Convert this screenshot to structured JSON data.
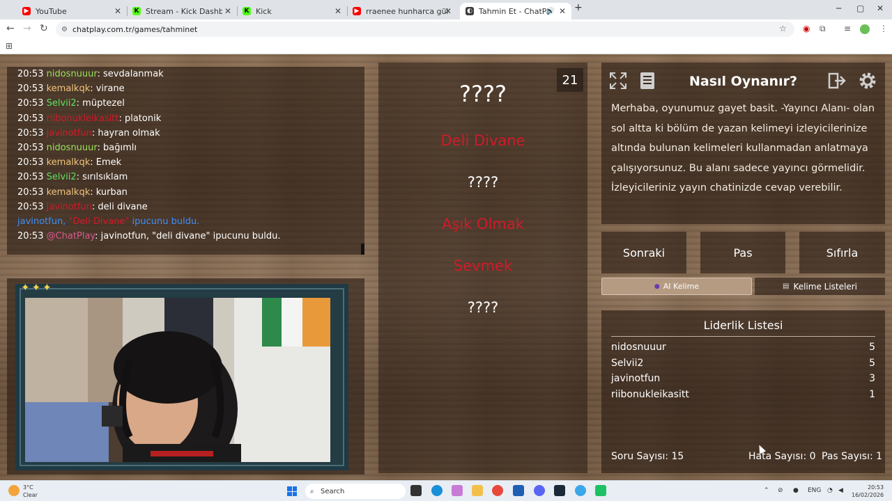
{
  "browser": {
    "tabs": [
      {
        "label": "YouTube",
        "favicon_color": "#ff0000",
        "favicon_glyph": "▶"
      },
      {
        "label": "Stream - Kick Dashboard",
        "favicon_color": "#53fc18",
        "favicon_glyph": "K"
      },
      {
        "label": "Kick",
        "favicon_color": "#53fc18",
        "favicon_glyph": "K"
      },
      {
        "label": "rraenee hunharca gülüyor - You",
        "favicon_color": "#ff0000",
        "favicon_glyph": "▶"
      },
      {
        "label": "Tahmin Et - ChatPlay",
        "favicon_color": "#3a3a3a",
        "favicon_glyph": "◐"
      }
    ],
    "url": "chatplay.com.tr/games/tahminet"
  },
  "chat": {
    "messages": [
      {
        "time": "20:53",
        "user": "nidosnuuur",
        "user_color": "#9be15d",
        "text": ": sevdalanmak"
      },
      {
        "time": "20:53",
        "user": "kemalkqk",
        "user_color": "#f2c57c",
        "text": ": virane"
      },
      {
        "time": "20:53",
        "user": "Selvii2",
        "user_color": "#5ee05e",
        "text": ": müptezel"
      },
      {
        "time": "20:53",
        "user": "riibonukleikasitt",
        "user_color": "#d11a2a",
        "text": ": platonik"
      },
      {
        "time": "20:53",
        "user": "javinotfun",
        "user_color": "#d11a2a",
        "text": ": hayran olmak"
      },
      {
        "time": "20:53",
        "user": "nidosnuuur",
        "user_color": "#9be15d",
        "text": ": bağımlı"
      },
      {
        "time": "20:53",
        "user": "kemalkqk",
        "user_color": "#f2c57c",
        "text": ": Emek"
      },
      {
        "time": "20:53",
        "user": "Selvii2",
        "user_color": "#5ee05e",
        "text": ": sırılsıklam"
      },
      {
        "time": "20:53",
        "user": "kemalkqk",
        "user_color": "#f2c57c",
        "text": ": kurban"
      },
      {
        "time": "20:53",
        "user": "javinotfun",
        "user_color": "#d11a2a",
        "text": ": deli divane"
      }
    ],
    "system_line": {
      "user": "javinotfun,",
      "hint": "\"Deli Divane\"",
      "rest": "ipucunu buldu."
    },
    "bot_line": {
      "time": "20:53",
      "user": "@ChatPlay",
      "user_color": "#d95a8f",
      "text": ": javinotfun, \"deli divane\" ipucunu buldu."
    }
  },
  "game": {
    "counter": "21",
    "words": [
      {
        "text": "????",
        "found": false,
        "big": true
      },
      {
        "text": "Deli Divane",
        "found": true,
        "big": false
      },
      {
        "text": "????",
        "found": false,
        "big": false
      },
      {
        "text": "Aşık Olmak",
        "found": true,
        "big": false
      },
      {
        "text": "Sevmek",
        "found": true,
        "big": false
      },
      {
        "text": "????",
        "found": false,
        "big": false
      }
    ]
  },
  "howto": {
    "title": "Nasıl Oynanır?",
    "text": "Merhaba, oyunumuz gayet basit. -Yayıncı Alanı- olan sol altta ki bölüm de yazan kelimeyi izleyicilerinize altında bulunan kelimeleri kullanmadan anlatmaya çalışıyorsunuz. Bu alanı sadece yayıncı görmelidir. İzleyicileriniz yayın chatinizde cevap verebilir."
  },
  "controls": {
    "next": "Sonraki",
    "pass": "Pas",
    "reset": "Sıfırla",
    "ai_word": "AI Kelime",
    "word_lists": "Kelime Listeleri"
  },
  "leaderboard": {
    "title": "Liderlik Listesi",
    "rows": [
      {
        "name": "nidosnuuur",
        "score": "5"
      },
      {
        "name": "Selvii2",
        "score": "5"
      },
      {
        "name": "javinotfun",
        "score": "3"
      },
      {
        "name": "riibonukleikasitt",
        "score": "1"
      }
    ],
    "question_count": "Soru Sayısı: 15",
    "error_count": "Hata Sayısı: 0",
    "pass_count": "Pas Sayısı: 1"
  },
  "taskbar": {
    "temp": "3°C",
    "weather": "Clear",
    "search": "Search",
    "lang": "ENG",
    "time": "20:53",
    "date": "16/02/2026"
  }
}
